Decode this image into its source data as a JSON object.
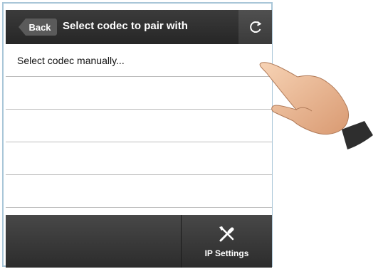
{
  "header": {
    "back_label": "Back",
    "title": "Select codec to pair with",
    "refresh_icon": "refresh-icon"
  },
  "list": {
    "items": [
      {
        "label": "Select codec manually..."
      },
      {
        "label": ""
      },
      {
        "label": ""
      },
      {
        "label": ""
      },
      {
        "label": ""
      }
    ]
  },
  "footer": {
    "ip_settings_label": "IP Settings",
    "ip_settings_icon": "tools-icon"
  },
  "colors": {
    "bar_dark": "#2b2b2b",
    "frame_border": "#a9c6d8"
  }
}
